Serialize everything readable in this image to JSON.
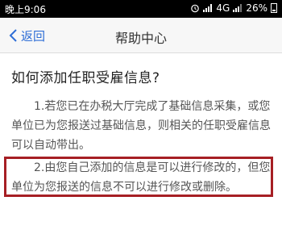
{
  "status_bar": {
    "time": "晚上9:06",
    "network": "4G",
    "battery": "26%"
  },
  "nav": {
    "back_label": "返回",
    "title": "帮助中心"
  },
  "content": {
    "question": "如何添加任职受雇信息?",
    "answer_1": "1.若您已在办税大厅完成了基础信息采集，或您单位已为您报送过基础信息，则相关的任职受雇信息可以自动带出。",
    "answer_2": "2.由您自己添加的信息是可以进行修改的，但您单位为您报送的信息不可以进行修改或删除。"
  },
  "colors": {
    "accent": "#2e6ed6",
    "highlight_border": "#a61f24"
  }
}
